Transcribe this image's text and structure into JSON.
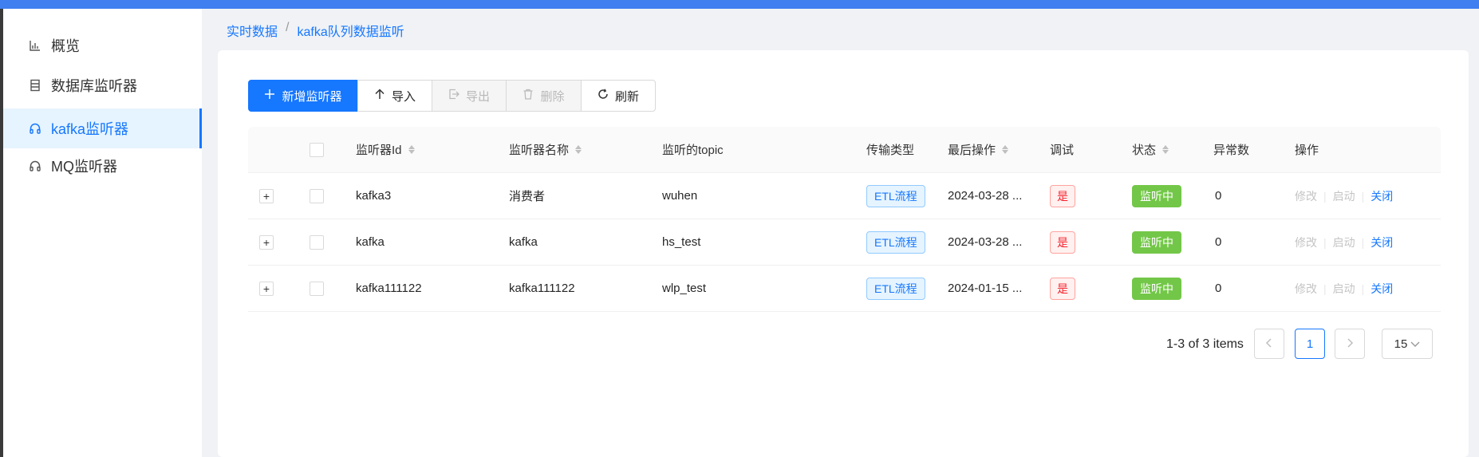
{
  "breadcrumb": {
    "root": "实时数据",
    "separator": "/",
    "current": "kafka队列数据监听"
  },
  "sidebar": {
    "items": [
      {
        "label": "概览",
        "icon": "bar-chart-icon",
        "active": false
      },
      {
        "label": "数据库监听器",
        "icon": "database-icon",
        "active": false
      },
      {
        "label": "kafka监听器",
        "icon": "headphones-icon",
        "active": true
      },
      {
        "label": "MQ监听器",
        "icon": "headphones-icon",
        "active": false
      }
    ]
  },
  "toolbar": {
    "add_label": "新增监听器",
    "import_label": "导入",
    "export_label": "导出",
    "delete_label": "删除",
    "refresh_label": "刷新"
  },
  "table": {
    "columns": {
      "id": "监听器Id",
      "name": "监听器名称",
      "topic": "监听的topic",
      "transfer": "传输类型",
      "last_op": "最后操作",
      "debug": "调试",
      "status": "状态",
      "errors": "异常数",
      "actions": "操作"
    },
    "rows": [
      {
        "id": "kafka3",
        "name": "消费者",
        "topic": "wuhen",
        "transfer": "ETL流程",
        "last_op": "2024-03-28 ...",
        "debug": "是",
        "status": "监听中",
        "errors": "0",
        "op_edit": "修改",
        "op_start": "启动",
        "op_close": "关闭"
      },
      {
        "id": "kafka",
        "name": "kafka",
        "topic": "hs_test",
        "transfer": "ETL流程",
        "last_op": "2024-03-28 ...",
        "debug": "是",
        "status": "监听中",
        "errors": "0",
        "op_edit": "修改",
        "op_start": "启动",
        "op_close": "关闭"
      },
      {
        "id": "kafka111122",
        "name": "kafka111122",
        "topic": "wlp_test",
        "transfer": "ETL流程",
        "last_op": "2024-01-15 ...",
        "debug": "是",
        "status": "监听中",
        "errors": "0",
        "op_edit": "修改",
        "op_start": "启动",
        "op_close": "关闭"
      }
    ],
    "expand_symbol": "+"
  },
  "pagination": {
    "summary": "1-3 of 3 items",
    "current_page": "1",
    "page_size": "15"
  },
  "colors": {
    "accent": "#1677ff",
    "topbar": "#3f7ff0",
    "status_green": "#73c748",
    "danger": "#f5222d"
  }
}
